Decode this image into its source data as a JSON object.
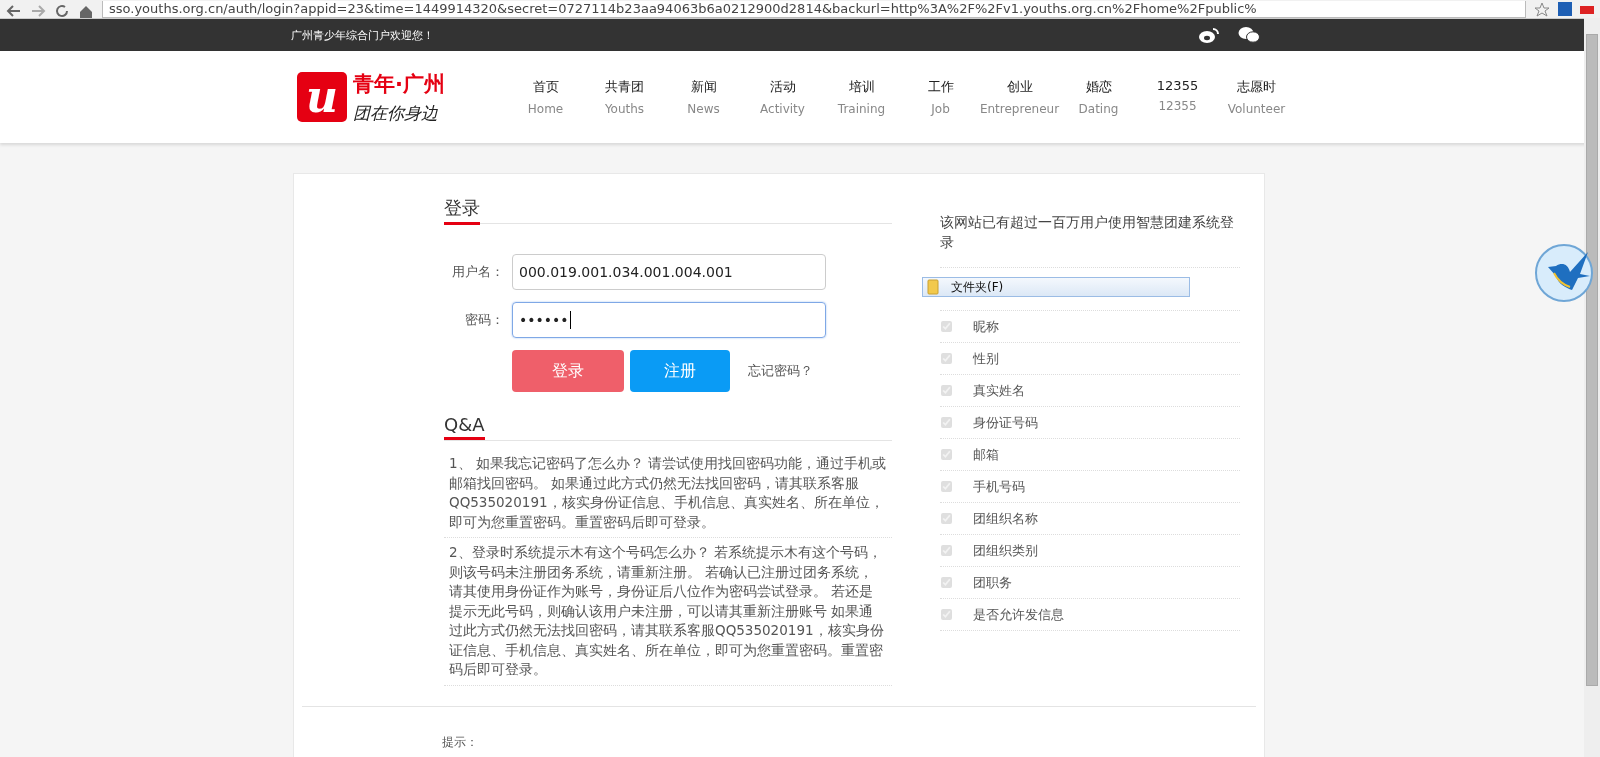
{
  "browser": {
    "url": "sso.youths.org.cn/auth/login?appid=23&time=1449914320&secret=0727114b23aa94063b6a0212900d2814&backurl=http%3A%2F%2Fv1.youths.org.cn%2Fhome%2Fpublic%"
  },
  "topbar": {
    "welcome": "广州青少年综合门户欢迎您！"
  },
  "logo": {
    "mark": "u",
    "title": "青年·广州",
    "slogan": "团在你身边"
  },
  "nav": [
    {
      "zh": "首页",
      "en": "Home"
    },
    {
      "zh": "共青团",
      "en": "Youths"
    },
    {
      "zh": "新闻",
      "en": "News"
    },
    {
      "zh": "活动",
      "en": "Activity"
    },
    {
      "zh": "培训",
      "en": "Training"
    },
    {
      "zh": "工作",
      "en": "Job"
    },
    {
      "zh": "创业",
      "en": "Entrepreneur"
    },
    {
      "zh": "婚恋",
      "en": "Dating"
    },
    {
      "zh": "12355",
      "en": "12355"
    },
    {
      "zh": "志愿时",
      "en": "Volunteer"
    }
  ],
  "login": {
    "title": "登录",
    "username_label": "用户名：",
    "username_value": "000.019.001.034.001.004.001",
    "password_label": "密码：",
    "password_value": "••••••",
    "login_button": "登录",
    "register_button": "注册",
    "forgot_link": "忘记密码？"
  },
  "qa": {
    "title": "Q&A",
    "items": [
      "1、 如果我忘记密码了怎么办？ 请尝试使用找回密码功能，通过手机或邮箱找回密码。 如果通过此方式仍然无法找回密码，请其联系客服QQ535020191，核实身份证信息、手机信息、真实姓名、所在单位，即可为您重置密码。重置密码后即可登录。",
      "2、登录时系统提示木有这个号码怎么办？ 若系统提示木有这个号码，则该号码未注册团务系统，请重新注册。 若确认已注册过团务系统，请其使用身份证作为账号，身份证后八位作为密码尝试登录。 若还是提示无此号码，则确认该用户未注册，可以请其重新注册账号 如果通过此方式仍然无法找回密码，请其联系客服QQ535020191，核实身份证信息、手机信息、真实姓名、所在单位，即可为您重置密码。重置密码后即可登录。"
    ]
  },
  "permissions": {
    "intro": "该网站已有超过一百万用户使用智慧团建系统登录",
    "popup": "文件夹(F)",
    "items": [
      {
        "label": "昵称",
        "checked": true
      },
      {
        "label": "性别",
        "checked": true
      },
      {
        "label": "真实姓名",
        "checked": true
      },
      {
        "label": "身份证号码",
        "checked": true
      },
      {
        "label": "邮箱",
        "checked": true
      },
      {
        "label": "手机号码",
        "checked": true
      },
      {
        "label": "团组织名称",
        "checked": true
      },
      {
        "label": "团组织类别",
        "checked": true
      },
      {
        "label": "团职务",
        "checked": true
      },
      {
        "label": "是否允许发信息",
        "checked": true
      }
    ]
  },
  "tip": {
    "label": "提示："
  }
}
